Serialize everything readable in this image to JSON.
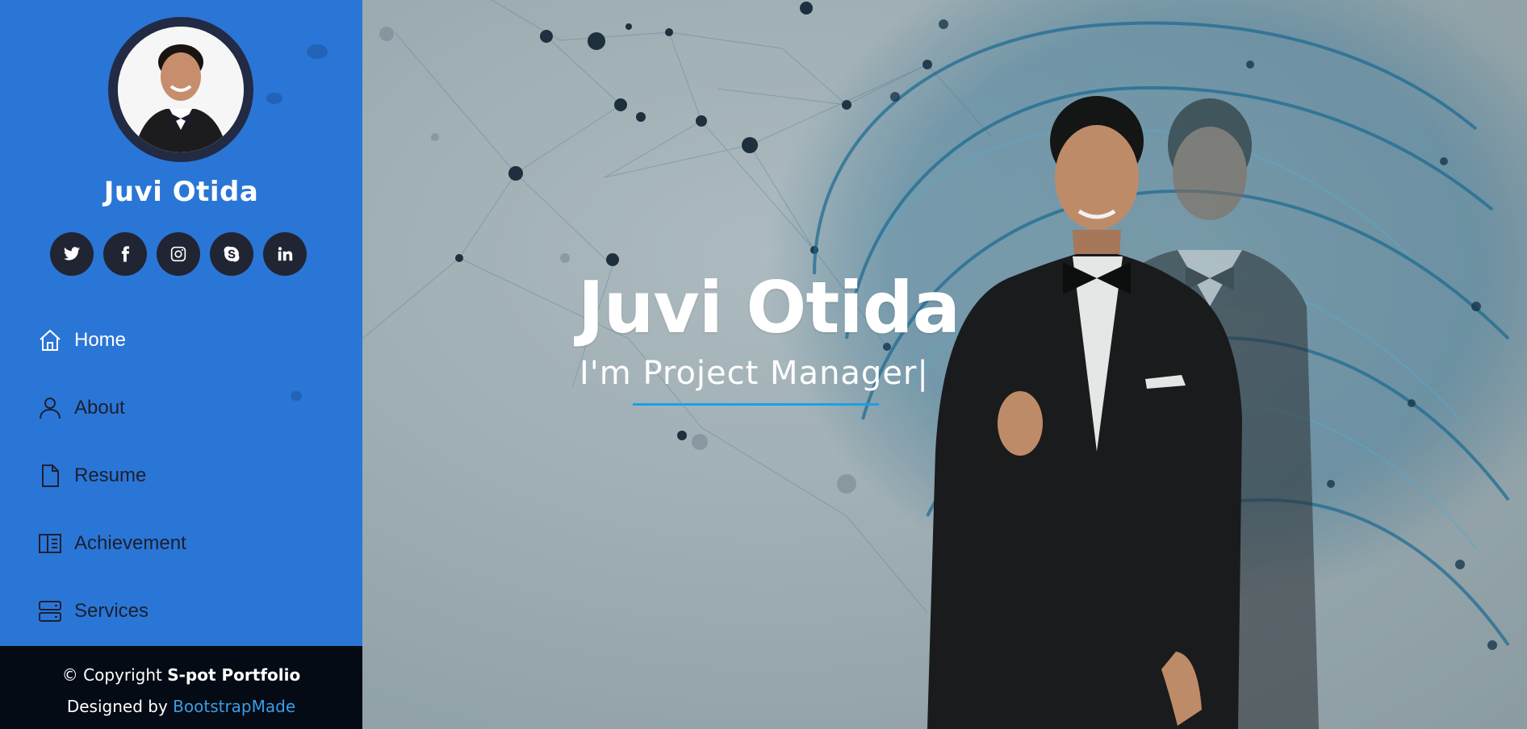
{
  "profile": {
    "name": "Juvi Otida"
  },
  "social": [
    {
      "icon": "twitter-icon"
    },
    {
      "icon": "facebook-icon"
    },
    {
      "icon": "instagram-icon"
    },
    {
      "icon": "skype-icon"
    },
    {
      "icon": "linkedin-icon"
    }
  ],
  "nav": [
    {
      "label": "Home",
      "icon": "home-icon",
      "active": true
    },
    {
      "label": "About",
      "icon": "person-icon",
      "active": false
    },
    {
      "label": "Resume",
      "icon": "file-icon",
      "active": false
    },
    {
      "label": "Achievement",
      "icon": "book-icon",
      "active": false
    },
    {
      "label": "Services",
      "icon": "server-icon",
      "active": false
    }
  ],
  "footer": {
    "copyright_prefix": "© Copyright",
    "copyright_brand": "S-pot Portfolio",
    "designed_prefix": "Designed by",
    "designed_link": "BootstrapMade"
  },
  "hero": {
    "title": "Juvi Otida",
    "subtitle": "I'm Project Manager|"
  },
  "colors": {
    "sidebar": "#2a76d6",
    "footer": "#040b14",
    "accent": "#1aa0e8",
    "social_bg": "#212433"
  }
}
